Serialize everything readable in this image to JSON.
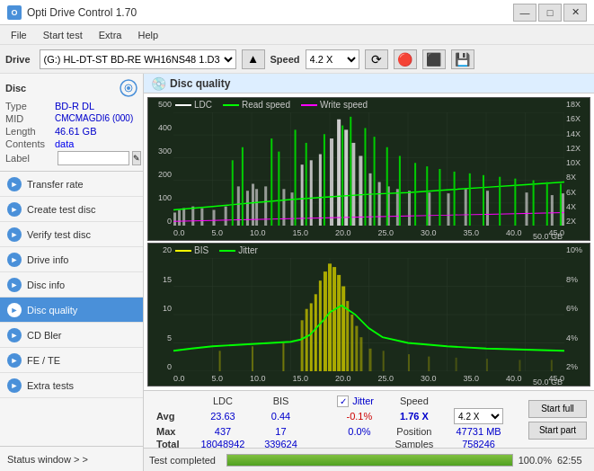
{
  "app": {
    "title": "Opti Drive Control 1.70",
    "icon_label": "O"
  },
  "titlebar": {
    "minimize": "—",
    "maximize": "□",
    "close": "✕"
  },
  "menu": {
    "items": [
      "File",
      "Start test",
      "Extra",
      "Help"
    ]
  },
  "drivebar": {
    "label": "Drive",
    "drive_value": "(G:)  HL-DT-ST BD-RE  WH16NS48 1.D3",
    "speed_label": "Speed",
    "speed_value": "4.2 X"
  },
  "disc": {
    "title": "Disc",
    "type_label": "Type",
    "type_value": "BD-R DL",
    "mid_label": "MID",
    "mid_value": "CMCMAGDI6 (000)",
    "length_label": "Length",
    "length_value": "46.61 GB",
    "contents_label": "Contents",
    "contents_value": "data",
    "label_label": "Label"
  },
  "nav": {
    "items": [
      {
        "id": "transfer-rate",
        "label": "Transfer rate",
        "icon": "►"
      },
      {
        "id": "create-test-disc",
        "label": "Create test disc",
        "icon": "►"
      },
      {
        "id": "verify-test-disc",
        "label": "Verify test disc",
        "icon": "►"
      },
      {
        "id": "drive-info",
        "label": "Drive info",
        "icon": "►"
      },
      {
        "id": "disc-info",
        "label": "Disc info",
        "icon": "►"
      },
      {
        "id": "disc-quality",
        "label": "Disc quality",
        "icon": "►",
        "active": true
      },
      {
        "id": "cd-bler",
        "label": "CD Bler",
        "icon": "►"
      },
      {
        "id": "fe-te",
        "label": "FE / TE",
        "icon": "►"
      },
      {
        "id": "extra-tests",
        "label": "Extra tests",
        "icon": "►"
      }
    ]
  },
  "status_window": {
    "label": "Status window > >"
  },
  "disc_quality": {
    "title": "Disc quality",
    "chart1": {
      "legend": [
        {
          "label": "LDC",
          "color": "#ffffff"
        },
        {
          "label": "Read speed",
          "color": "#00ff00"
        },
        {
          "label": "Write speed",
          "color": "#ff00ff"
        }
      ],
      "y_left": [
        "500",
        "400",
        "300",
        "200",
        "100",
        "0"
      ],
      "y_right": [
        "18X",
        "16X",
        "14X",
        "12X",
        "10X",
        "8X",
        "6X",
        "4X",
        "2X"
      ],
      "x_vals": [
        "0.0",
        "5.0",
        "10.0",
        "15.0",
        "20.0",
        "25.0",
        "30.0",
        "35.0",
        "40.0",
        "45.0",
        "50.0 GB"
      ]
    },
    "chart2": {
      "legend": [
        {
          "label": "BIS",
          "color": "#ffff00"
        },
        {
          "label": "Jitter",
          "color": "#00ff00"
        }
      ],
      "y_left": [
        "20",
        "15",
        "10",
        "5",
        "0"
      ],
      "y_right": [
        "10%",
        "8%",
        "6%",
        "4%",
        "2%"
      ],
      "x_vals": [
        "0.0",
        "5.0",
        "10.0",
        "15.0",
        "20.0",
        "25.0",
        "30.0",
        "35.0",
        "40.0",
        "45.0",
        "50.0 GB"
      ]
    }
  },
  "stats": {
    "columns": [
      "",
      "LDC",
      "BIS",
      "",
      "Jitter",
      "Speed",
      ""
    ],
    "avg_label": "Avg",
    "avg_ldc": "23.63",
    "avg_bis": "0.44",
    "avg_jitter": "-0.1%",
    "max_label": "Max",
    "max_ldc": "437",
    "max_bis": "17",
    "max_jitter": "0.0%",
    "total_label": "Total",
    "total_ldc": "18048942",
    "total_bis": "339624",
    "jitter_checked": true,
    "jitter_label": "Jitter",
    "speed_label": "Speed",
    "speed_value": "1.76 X",
    "speed_select": "4.2 X",
    "position_label": "Position",
    "position_value": "47731 MB",
    "samples_label": "Samples",
    "samples_value": "758246",
    "start_full_label": "Start full",
    "start_part_label": "Start part"
  },
  "progress": {
    "status": "Test completed",
    "percent": 100,
    "percent_text": "100.0%",
    "time": "62:55"
  }
}
